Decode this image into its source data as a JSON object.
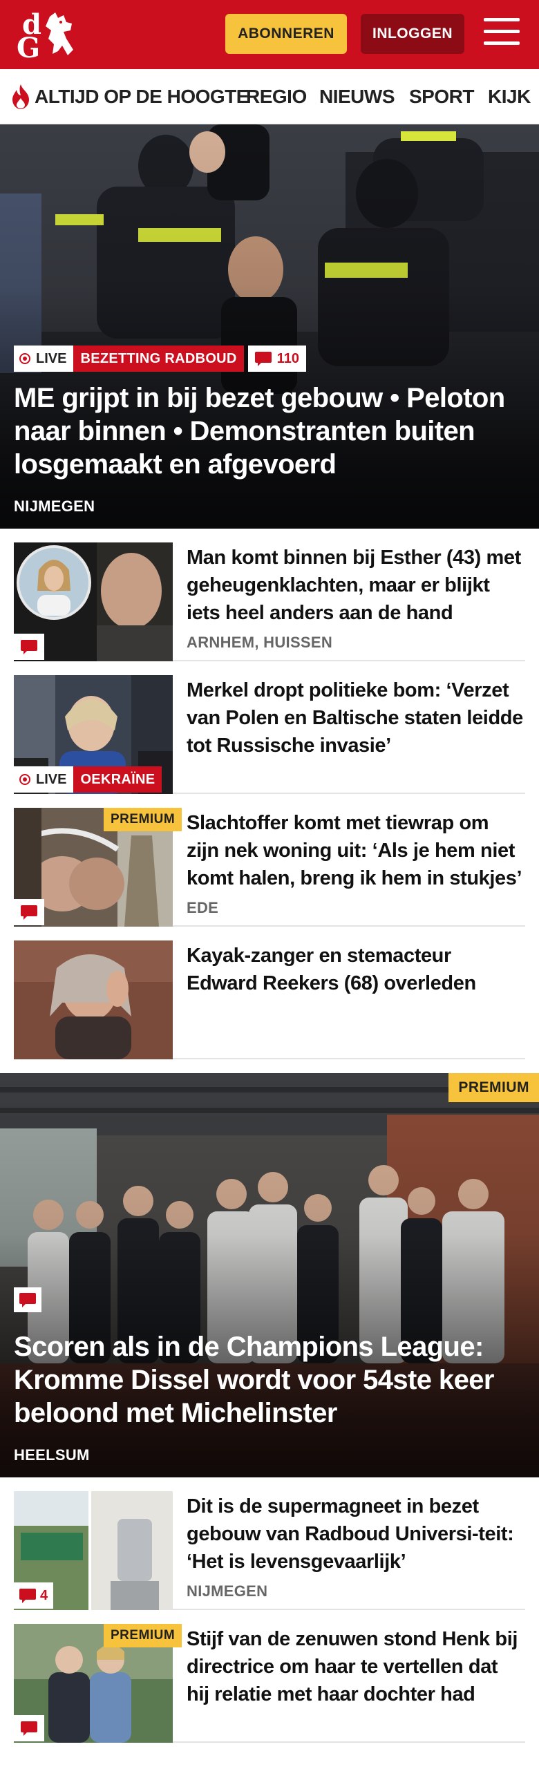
{
  "header": {
    "logo_text_top": "d",
    "logo_text_bottom": "G",
    "subscribe_label": "ABONNEREN",
    "login_label": "INLOGGEN"
  },
  "nav": {
    "items": [
      "ALTIJD OP DE HOOGTE",
      "REGIO",
      "NIEUWS",
      "SPORT",
      "KIJK"
    ]
  },
  "hero1": {
    "live_label": "LIVE",
    "topic_label": "BEZETTING RADBOUD",
    "comment_count": "110",
    "title": "ME grijpt in bij bezet gebouw • Peloton naar binnen • Demonstranten buiten losgemaakt en afgevoerd",
    "location": "NIJMEGEN"
  },
  "articles_a": [
    {
      "title": "Man komt binnen bij Esther (43) met geheugenklachten, maar er blijkt iets heel anders aan de hand",
      "location": "ARNHEM, HUISSEN"
    },
    {
      "title": "Merkel dropt politieke bom: ‘Verzet van Polen en Baltische staten leidde tot Russische invasie’",
      "live_label": "LIVE",
      "topic_label": "OEKRAÏNE"
    },
    {
      "title": "Slachtoffer komt met tiewrap om zijn nek woning uit: ‘Als je hem niet komt halen, breng ik hem in stukjes’",
      "location": "EDE",
      "premium_label": "PREMIUM"
    },
    {
      "title": "Kayak-zanger en stemacteur Edward Reekers (68) overleden"
    }
  ],
  "hero2": {
    "premium_label": "PREMIUM",
    "title": "Scoren als in de Champions League: Kromme Dissel wordt voor 54ste keer beloond met Michelinster",
    "location": "HEELSUM"
  },
  "articles_b": [
    {
      "title": "Dit is de supermagneet in bezet gebouw van Radboud Universi-teit: ‘Het is levensgevaarlijk’",
      "location": "NIJMEGEN",
      "comment_count": "4"
    },
    {
      "title": "Stijf van de zenuwen stond Henk bij directrice om haar te vertellen dat hij relatie met haar dochter had",
      "premium_label": "PREMIUM"
    }
  ],
  "colors": {
    "brand_red": "#cc0f1f",
    "premium_yellow": "#f7c23c",
    "login_dark_red": "#8d0b14"
  }
}
